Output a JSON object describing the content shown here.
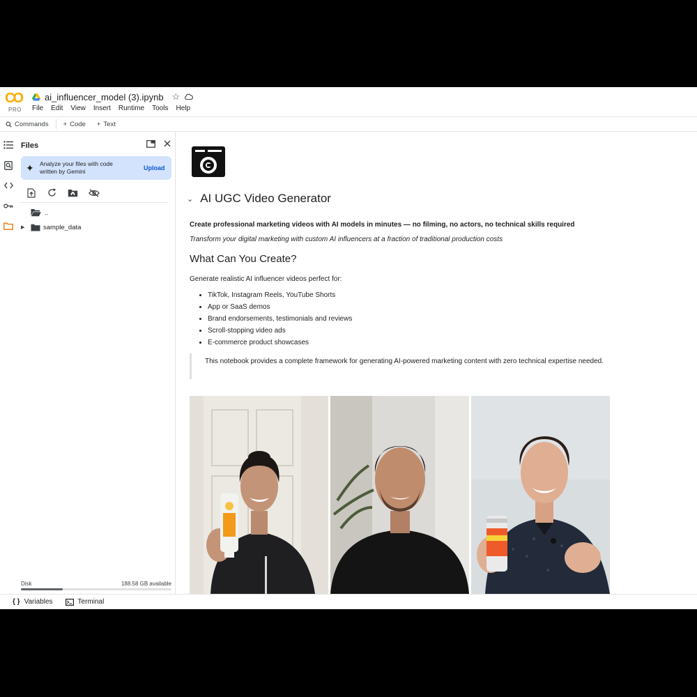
{
  "app": {
    "logo_text": "CO",
    "logo_badge": "PRO",
    "notebook_title": "ai_influencer_model (3).ipynb",
    "brand_color": "#f9ab00"
  },
  "menu": [
    "File",
    "Edit",
    "View",
    "Insert",
    "Runtime",
    "Tools",
    "Help"
  ],
  "toolbar": {
    "commands_label": "Commands",
    "code_label": "Code",
    "text_label": "Text"
  },
  "files_panel": {
    "title": "Files",
    "gemini_text": "Analyze your files with code written by Gemini",
    "upload_label": "Upload",
    "tree": [
      {
        "name": ".."
      },
      {
        "name": "sample_data"
      }
    ],
    "disk_label": "Disk",
    "disk_available": "188.58 GB available",
    "disk_usage_fraction": 0.28
  },
  "notebook": {
    "heading": "AI UGC Video Generator",
    "lead": "Create professional marketing videos with AI models in minutes — no filming, no actors, no technical skills required",
    "subtitle": "Transform your digital marketing with custom AI influencers at a fraction of traditional production costs",
    "section_heading": "What Can You Create?",
    "intro": "Generate realistic AI influencer videos perfect for:",
    "bullets": [
      "TikTok, Instagram Reels, YouTube Shorts",
      "App or SaaS demos",
      "Brand endorsements, testimonials and reviews",
      "Scroll-stopping video ads",
      "E-commerce product showcases"
    ],
    "quote": "This notebook provides a complete framework for generating AI-powered marketing content with zero technical expertise needed."
  },
  "bottom_bar": {
    "variables_label": "Variables",
    "terminal_label": "Terminal"
  }
}
